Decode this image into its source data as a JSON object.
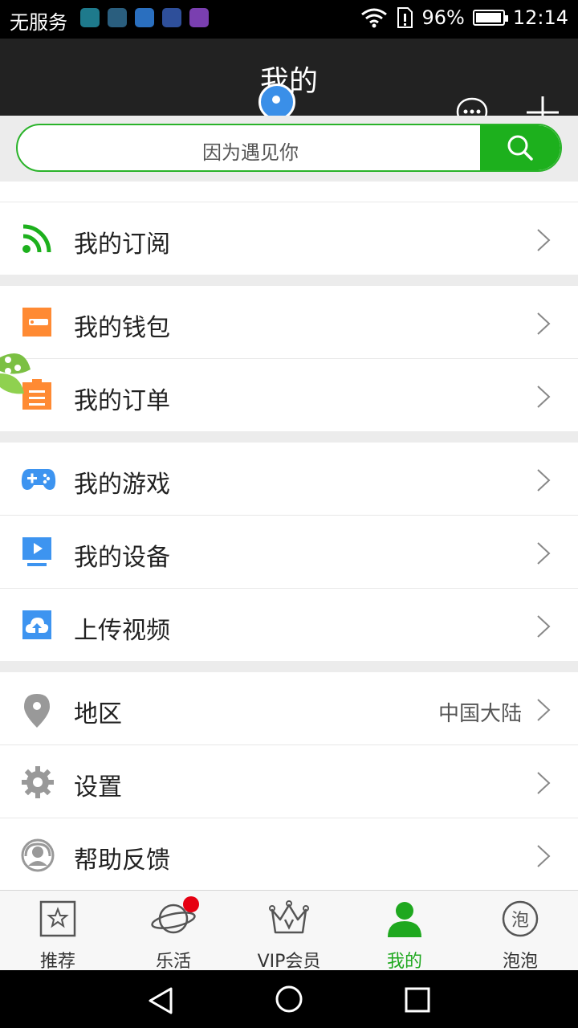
{
  "status": {
    "carrier": "无服务",
    "battery": "96%",
    "battery_level": 0.96,
    "time": "12:14",
    "app_icon_colors": [
      "#1e7a8c",
      "#2a5e7e",
      "#2a6fbf",
      "#2e4f9a",
      "#7a3fb0"
    ]
  },
  "header": {
    "title": "我的",
    "chat_icon": "chat-bubble-icon",
    "add_icon": "plus-icon"
  },
  "search": {
    "placeholder": "因为遇见你",
    "icon": "search-icon"
  },
  "groups": [
    [
      {
        "label": "我的订阅",
        "icon": "rss-icon",
        "color": "#1db01d"
      }
    ],
    [
      {
        "label": "我的钱包",
        "icon": "wallet-icon",
        "color": "#ff8a33"
      },
      {
        "label": "我的订单",
        "icon": "order-icon",
        "color": "#ff8a33"
      }
    ],
    [
      {
        "label": "我的游戏",
        "icon": "gamepad-icon",
        "color": "#3d94f0"
      },
      {
        "label": "我的设备",
        "icon": "device-icon",
        "color": "#3d94f0"
      },
      {
        "label": "上传视频",
        "icon": "upload-cloud-icon",
        "color": "#3d94f0"
      }
    ],
    [
      {
        "label": "地区",
        "value": "中国大陆",
        "icon": "location-pin-icon",
        "color": "#999999"
      },
      {
        "label": "设置",
        "icon": "gear-icon",
        "color": "#999999"
      },
      {
        "label": "帮助反馈",
        "icon": "headset-icon",
        "color": "#999999"
      }
    ]
  ],
  "tabs": [
    {
      "label": "推荐",
      "icon": "star-box-icon"
    },
    {
      "label": "乐活",
      "icon": "planet-icon",
      "badge": true
    },
    {
      "label": "VIP会员",
      "icon": "crown-icon"
    },
    {
      "label": "我的",
      "icon": "person-icon",
      "active": true
    },
    {
      "label": "泡泡",
      "icon": "bubble-pao-icon"
    }
  ],
  "colors": {
    "accent": "#1db01d",
    "active_tab": "#1fa81f",
    "header_bg": "#222222"
  }
}
